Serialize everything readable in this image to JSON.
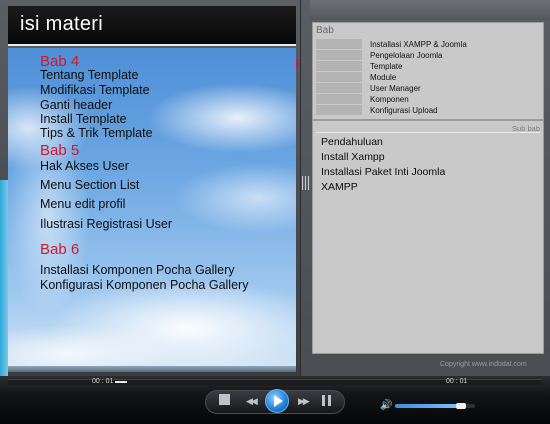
{
  "left_panel": {
    "title": "isi materi",
    "marker": "B",
    "sections": [
      {
        "heading": "Bab 4",
        "items": [
          "Tentang Template",
          "Modifikasi Template",
          "Ganti header",
          "Install Template",
          "Tips & Trik Template"
        ]
      },
      {
        "heading": "Bab 5",
        "items": [
          "Hak Akses User",
          "Menu Section List",
          "Menu edit profil",
          "Ilustrasi Registrasi User"
        ]
      },
      {
        "heading": "Bab 6",
        "items": [
          "Installasi Komponen Pocha Gallery",
          "Konfigurasi Komponen Pocha Gallery"
        ]
      }
    ]
  },
  "right_panel": {
    "bab_label": "Bab",
    "bab_items": [
      "Installasi XAMPP & Joomla",
      "Pengelolaan Joomla",
      "Template",
      "Module",
      "User Manager",
      "Komponen",
      "Konfigurasi Upload"
    ],
    "subbab_label": "Sub bab",
    "subbab_items": [
      "Pendahuluan",
      "Install Xampp",
      "Installasi  Paket Inti Joomla",
      "XAMPP"
    ],
    "copyright": "Copyright www.indodat.com"
  },
  "player": {
    "time_left": "00 : 01",
    "time_right": "00 : 01",
    "stop_icon": "stop-icon",
    "rewind_icon": "rewind-icon",
    "play_icon": "play-icon",
    "forward_icon": "fast-forward-icon",
    "pause_icon": "pause-icon",
    "volume_icon": "speaker-icon",
    "volume_level": 0.82,
    "seek_position": 0.2,
    "accent": "#1f7fd6"
  }
}
